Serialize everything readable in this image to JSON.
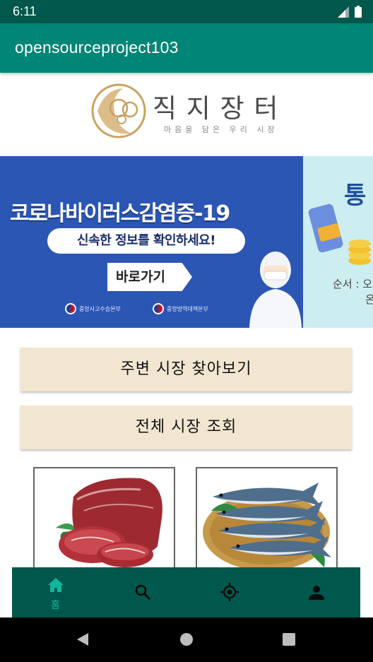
{
  "status_bar": {
    "time": "6:11"
  },
  "app_bar": {
    "title": "opensourceproject103"
  },
  "logo": {
    "title": "직 지 장 터",
    "subtitle": "마음을 담은 우리 시장"
  },
  "banner": {
    "headline": "코로나바이러스감염증-19",
    "info": "신속한 정보를 확인하세요!",
    "button": "바로가기",
    "org_left": "중앙사고수습본부",
    "org_right": "중앙방역대책본부"
  },
  "banner2": {
    "char": "통",
    "line1": "순서 : 오",
    "line2": "온"
  },
  "buttons": {
    "nearby": "주변 시장 찾아보기",
    "all": "전체 시장 조회"
  },
  "products": [
    {
      "name": "meat-image"
    },
    {
      "name": "fish-image"
    }
  ],
  "bottom_nav": {
    "items": [
      {
        "label": "홈",
        "icon": "home-icon",
        "active": true
      },
      {
        "label": "",
        "icon": "search-icon"
      },
      {
        "label": "",
        "icon": "location-target-icon"
      },
      {
        "label": "",
        "icon": "person-icon"
      }
    ]
  },
  "colors": {
    "status_bar": "#00574b",
    "app_bar": "#008577",
    "button_bg": "#f2e6d1",
    "bottom_nav": "#00574b",
    "active_nav": "#14b5a0",
    "banner_blue": "#2b56b4"
  }
}
